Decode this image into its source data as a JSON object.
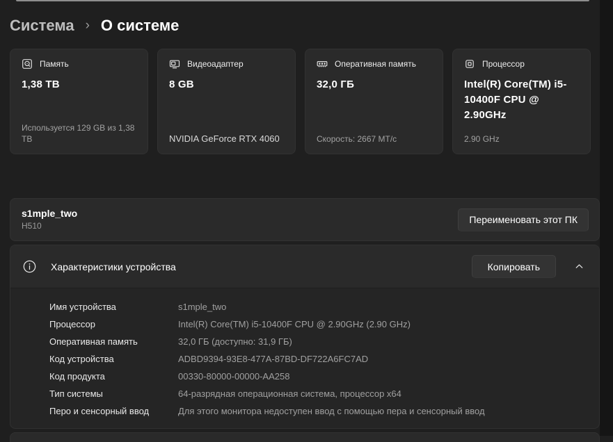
{
  "breadcrumb": {
    "root": "Система",
    "separator": "›",
    "current": "О системе"
  },
  "summary_cards": [
    {
      "icon": "storage-icon",
      "title": "Память",
      "value": "1,38 TB",
      "detail": "Используется 129 GB из 1,38 TB"
    },
    {
      "icon": "gpu-icon",
      "title": "Видеоадаптер",
      "value": "8 GB",
      "detail": "NVIDIA GeForce RTX 4060"
    },
    {
      "icon": "ram-icon",
      "title": "Оперативная память",
      "value": "32,0 ГБ",
      "detail": "Скорость: 2667 МТ/с"
    },
    {
      "icon": "cpu-icon",
      "title": "Процессор",
      "value": "Intel(R) Core(TM) i5-10400F CPU @ 2.90GHz",
      "detail": "2.90 GHz"
    }
  ],
  "device": {
    "name": "s1mple_two",
    "model": "H510",
    "rename_button_label": "Переименовать этот ПК"
  },
  "specs": {
    "title": "Характеристики устройства",
    "copy_button_label": "Копировать",
    "rows": [
      {
        "label": "Имя устройства",
        "value": "s1mple_two"
      },
      {
        "label": "Процессор",
        "value": "Intel(R) Core(TM) i5-10400F CPU @ 2.90GHz (2.90 GHz)"
      },
      {
        "label": "Оперативная память",
        "value": "32,0 ГБ (доступно: 31,9 ГБ)"
      },
      {
        "label": "Код устройства",
        "value": "ADBD9394-93E8-477A-87BD-DF722A6FC7AD"
      },
      {
        "label": "Код продукта",
        "value": "00330-80000-00000-AA258"
      },
      {
        "label": "Тип системы",
        "value": "64-разрядная операционная система, процессор x64"
      },
      {
        "label": "Перо и сенсорный ввод",
        "value": "Для этого монитора недоступен ввод с помощью пера и сенсорный ввод"
      }
    ]
  },
  "colors": {
    "page_background": "#1f1f1f",
    "card_background": "#2a2a2a",
    "expander_body_background": "#252525",
    "primary_text": "#ffffff",
    "secondary_text": "#a0a0a0"
  }
}
